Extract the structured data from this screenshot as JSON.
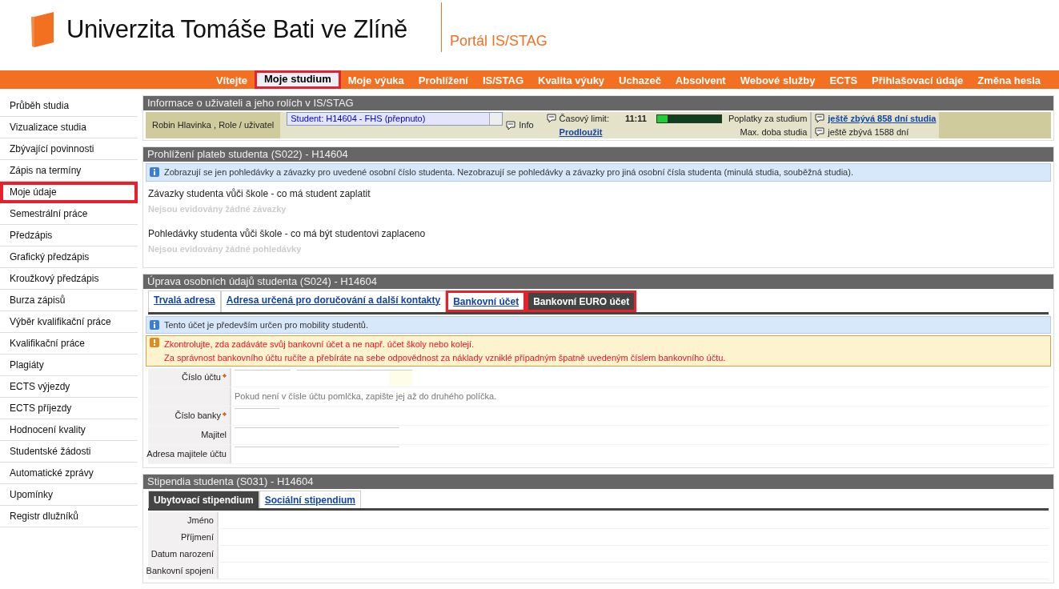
{
  "header": {
    "university": "Univerzita Tomáše Bati ve Zlíně",
    "portal": "Portál IS/STAG"
  },
  "menu": [
    {
      "label": "Vítejte",
      "selected": false,
      "highlighted": false
    },
    {
      "label": "Moje studium",
      "selected": true,
      "highlighted": true
    },
    {
      "label": "Moje výuka",
      "selected": false,
      "highlighted": false
    },
    {
      "label": "Prohlížení",
      "selected": false,
      "highlighted": false
    },
    {
      "label": "IS/STAG",
      "selected": false,
      "highlighted": false
    },
    {
      "label": "Kvalita výuky",
      "selected": false,
      "highlighted": false
    },
    {
      "label": "Uchazeč",
      "selected": false,
      "highlighted": false
    },
    {
      "label": "Absolvent",
      "selected": false,
      "highlighted": false
    },
    {
      "label": "Webové služby",
      "selected": false,
      "highlighted": false
    },
    {
      "label": "ECTS",
      "selected": false,
      "highlighted": false
    },
    {
      "label": "Přihlašovací údaje",
      "selected": false,
      "highlighted": false
    },
    {
      "label": "Změna hesla",
      "selected": false,
      "highlighted": false
    }
  ],
  "sidebar": [
    {
      "label": "Průběh studia",
      "highlighted": false
    },
    {
      "label": "Vizualizace studia",
      "highlighted": false
    },
    {
      "label": "Zbývající povinnosti",
      "highlighted": false
    },
    {
      "label": "Zápis na termíny",
      "highlighted": false
    },
    {
      "label": "Moje údaje",
      "highlighted": true
    },
    {
      "label": "Semestrální práce",
      "highlighted": false
    },
    {
      "label": "Předzápis",
      "highlighted": false
    },
    {
      "label": "Grafický předzápis",
      "highlighted": false
    },
    {
      "label": "Kroužkový předzápis",
      "highlighted": false
    },
    {
      "label": "Burza zápisů",
      "highlighted": false
    },
    {
      "label": "Výběr kvalifikační práce",
      "highlighted": false
    },
    {
      "label": "Kvalifikační práce",
      "highlighted": false
    },
    {
      "label": "Plagiáty",
      "highlighted": false
    },
    {
      "label": "ECTS výjezdy",
      "highlighted": false
    },
    {
      "label": "ECTS příjezdy",
      "highlighted": false
    },
    {
      "label": "Hodnocení kvality",
      "highlighted": false
    },
    {
      "label": "Studentské žádosti",
      "highlighted": false
    },
    {
      "label": "Automatické zprávy",
      "highlighted": false
    },
    {
      "label": "Upomínky",
      "highlighted": false
    },
    {
      "label": "Registr dlužníků",
      "highlighted": false
    }
  ],
  "user_panel": {
    "title": "Informace o uživateli a jeho rolích v IS/STAG",
    "user": "Robin Hlavinka , Role / uživatel",
    "role_select": "Student: H14604 - FHS (přepnuto)",
    "info": "Info",
    "time_limit_label": "Časový limit:",
    "time": "11:11",
    "level": 0.17,
    "extend_link": "Prodloužit",
    "fees_label": "Poplatky za studium",
    "max_label": "Max. doba studia",
    "remaining_link": "ještě zbývá **858** dní studia",
    "remaining_days": "ještě zbývá 1588 dní"
  },
  "payments": {
    "title": "Prohlížení plateb studenta (S022) - H14604",
    "info": "Zobrazují se jen pohledávky a závazky pro uvedené osobní číslo studenta. Nezobrazují se pohledávky a závazky pro jiná osobní čísla studenta (minulá studia, souběžná studia).",
    "sections": [
      {
        "heading": "Závazky studenta vůči škole - co má student zaplatit",
        "empty": "Nejsou evidovány žádné závazky"
      },
      {
        "heading": "Pohledávky studenta vůči škole - co má být studentovi zaplaceno",
        "empty": "Nejsou evidovány žádné pohledávky"
      }
    ]
  },
  "personal": {
    "title": "Úprava osobních údajů studenta (S024) - H14604",
    "tabs": [
      {
        "label": "Trvalá adresa",
        "selected": false,
        "highlighted": false
      },
      {
        "label": "Adresa určená pro doručování a další kontakty",
        "selected": false,
        "highlighted": false
      },
      {
        "label": "Bankovní účet",
        "selected": false,
        "highlighted": true
      },
      {
        "label": "Bankovní EURO účet",
        "selected": true,
        "highlighted": true
      }
    ],
    "info": "Tento účet je především určen pro mobility studentů.",
    "warning": [
      "Zkontrolujte, zda zadáváte svůj bankovní účet a ne např. účet školy nebo kolejí.",
      "Za správnost bankovního účtu ručíte a přebíráte na sebe odpovědnost za náklady vzniklé případným špatně uvedeným číslem bankovního účtu."
    ],
    "rows": [
      {
        "kind": "split",
        "label": "Číslo účtu",
        "required": true
      },
      {
        "kind": "hint",
        "text": "Pokud není v čísle účtu pomlčka, zapište jej až do druhého políčka."
      },
      {
        "kind": "short",
        "label": "Číslo banky",
        "required": true
      },
      {
        "kind": "long",
        "label": "Majitel",
        "required": false
      },
      {
        "kind": "long",
        "label": "Adresa majitele účtu",
        "required": false
      }
    ]
  },
  "scholarships": {
    "title": "Stipendia studenta (S031) - H14604",
    "tabs": [
      {
        "label": "Ubytovací stipendium",
        "selected": true
      },
      {
        "label": "Sociální stipendium",
        "selected": false
      }
    ],
    "fields": [
      "Jméno",
      "Příjmení",
      "Datum narození",
      "Bankovní spojení"
    ]
  }
}
